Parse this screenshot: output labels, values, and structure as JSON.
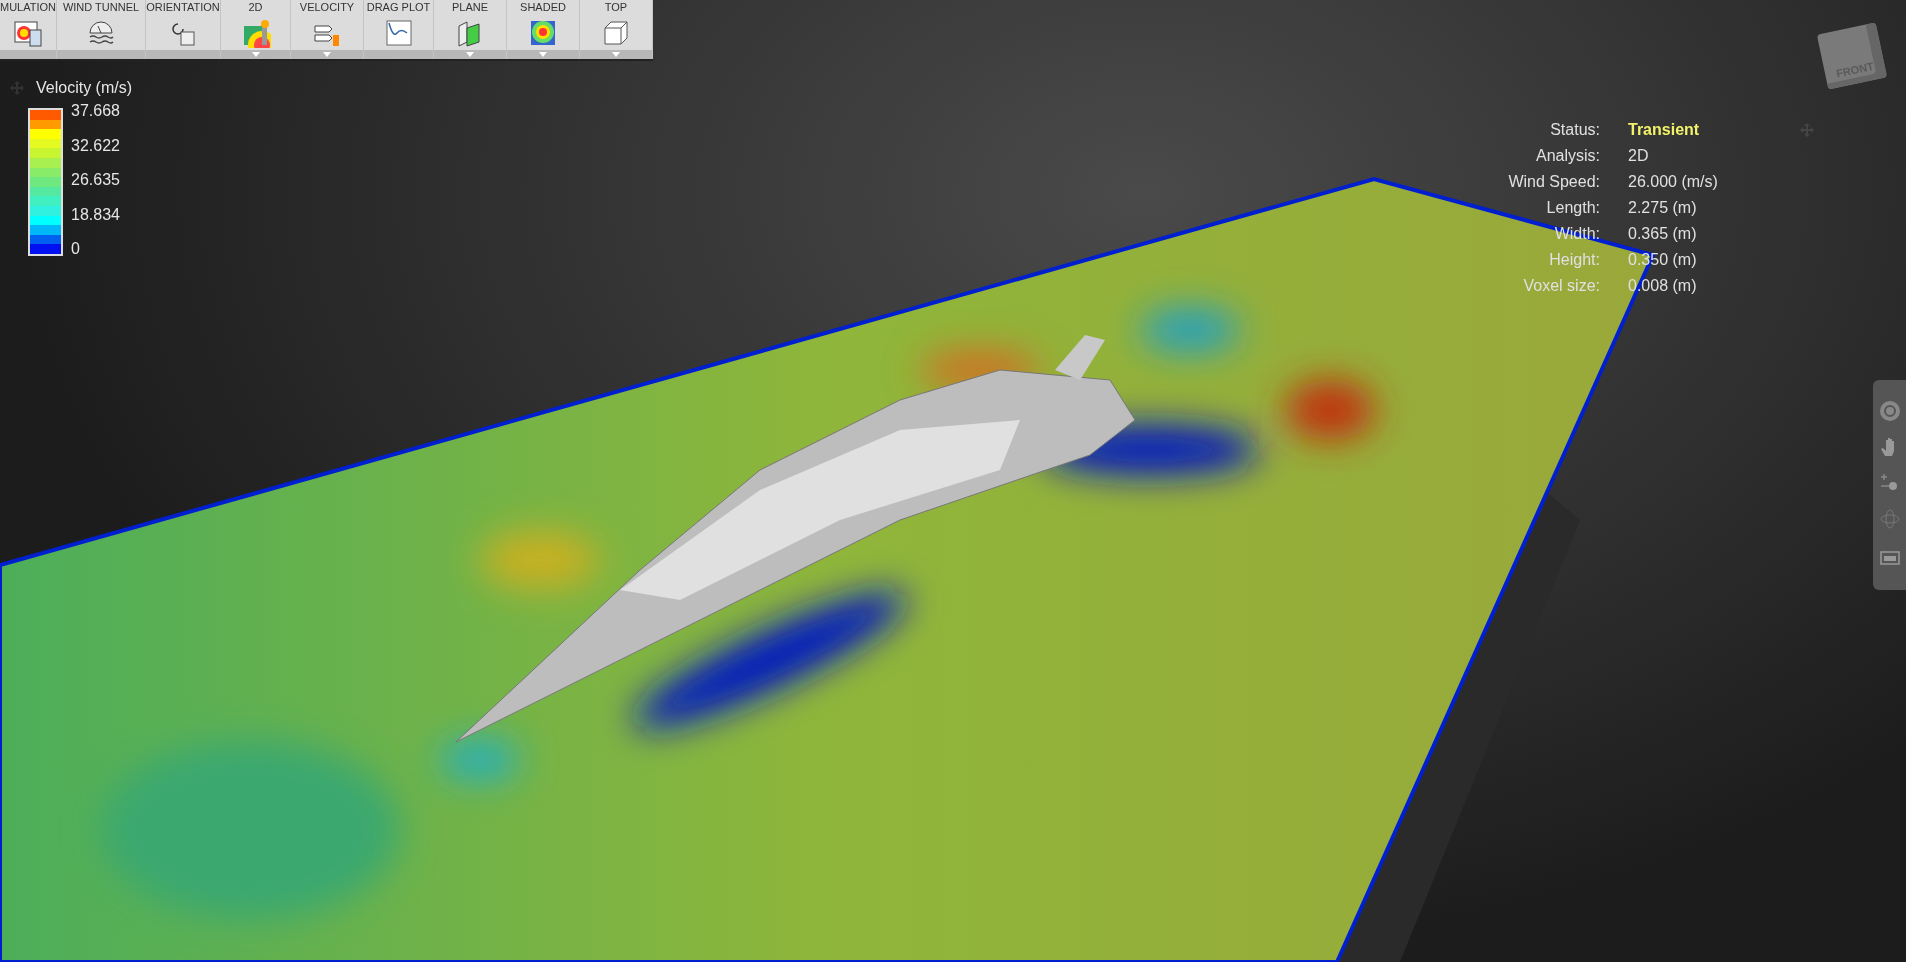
{
  "toolbar": {
    "buttons": [
      {
        "label": "MULATION",
        "dropdown": false
      },
      {
        "label": "WIND TUNNEL",
        "dropdown": false
      },
      {
        "label": "ORIENTATION",
        "dropdown": false
      },
      {
        "label": "2D",
        "dropdown": true
      },
      {
        "label": "VELOCITY",
        "dropdown": true
      },
      {
        "label": "DRAG PLOT",
        "dropdown": false
      },
      {
        "label": "PLANE",
        "dropdown": true
      },
      {
        "label": "SHADED",
        "dropdown": true
      },
      {
        "label": "TOP",
        "dropdown": true
      }
    ]
  },
  "legend": {
    "title": "Velocity (m/s)",
    "labels": [
      "37.668",
      "32.622",
      "26.635",
      "18.834",
      "0"
    ]
  },
  "info": {
    "rows": [
      {
        "label": "Status:",
        "value": "Transient",
        "kind": "status"
      },
      {
        "label": "Analysis:",
        "value": "2D",
        "kind": "plain"
      },
      {
        "label": "Wind Speed:",
        "value": "26.000 (m/s)",
        "kind": "plain"
      },
      {
        "label": "Length:",
        "value": "2.275 (m)",
        "kind": "plain"
      },
      {
        "label": "Width:",
        "value": "0.365 (m)",
        "kind": "plain"
      },
      {
        "label": "Height:",
        "value": "0.350 (m)",
        "kind": "plain"
      },
      {
        "label": "Voxel size:",
        "value": "0.008 (m)",
        "kind": "plain"
      }
    ]
  },
  "viewcube": {
    "face_label": "FRONT"
  }
}
